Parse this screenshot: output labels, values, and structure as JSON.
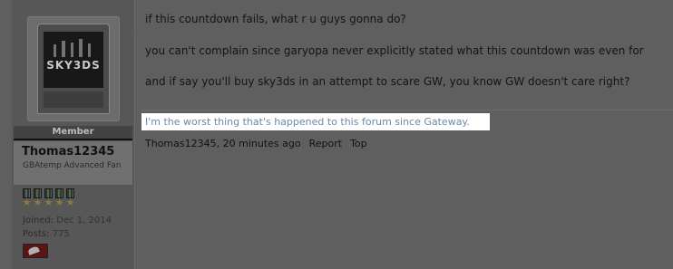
{
  "sidebar": {
    "avatar_text": "SKY3DS",
    "rank": "Member",
    "username": "Thomas12345",
    "user_title": "GBAtemp Advanced Fan",
    "stats": {
      "joined_label": "Joined:",
      "joined_value": "Dec 1, 2014",
      "posts_label": "Posts:",
      "posts_value": "775"
    },
    "medal_count": 5
  },
  "post": {
    "lines": [
      "if this countdown fails, what r u guys gonna do?",
      "you can't complain since garyopa never explicitly stated what this countdown was even for",
      "and if say you'll buy sky3ds in an attempt to scare GW, you know GW doesn't care right?"
    ],
    "signature": "I'm the worst thing that's happened to this forum since Gateway.",
    "meta": {
      "author": "Thomas12345",
      "time": "20 minutes ago",
      "report": "Report",
      "top": "Top"
    }
  }
}
